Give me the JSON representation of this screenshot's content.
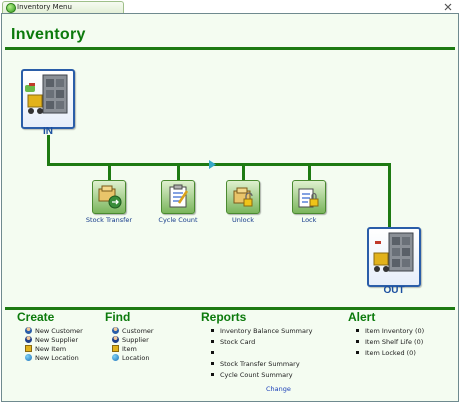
{
  "tab": {
    "label": "Inventory Menu"
  },
  "page": {
    "title": "Inventory"
  },
  "flow": {
    "in_label": "IN",
    "out_label": "OUT",
    "actions": [
      {
        "label": "Stock Transfer",
        "icon": "stock-transfer-icon"
      },
      {
        "label": "Cycle Count",
        "icon": "cycle-count-icon"
      },
      {
        "label": "Unlock",
        "icon": "unlock-icon"
      },
      {
        "label": "Lock",
        "icon": "lock-icon"
      }
    ]
  },
  "sections": {
    "create": {
      "title": "Create",
      "items": [
        "New Customer",
        "New Supplier",
        "New Item",
        "New Location"
      ]
    },
    "find": {
      "title": "Find",
      "items": [
        "Customer",
        "Supplier",
        "Item",
        "Location"
      ]
    },
    "reports": {
      "title": "Reports",
      "items": [
        "Inventory Balance Summary",
        "Stock Card",
        "",
        "Stock Transfer Summary",
        "Cycle Count Summary"
      ],
      "change_label": "Change"
    },
    "alert": {
      "title": "Alert",
      "items": [
        "Item Inventory (0)",
        "Item Shelf Life (0)",
        "Item Locked (0)"
      ]
    }
  },
  "colors": {
    "accent": "#0c7a0c",
    "line": "#1d7a12",
    "panel": "#f4fcf1",
    "tile_border": "#2a5da8"
  }
}
